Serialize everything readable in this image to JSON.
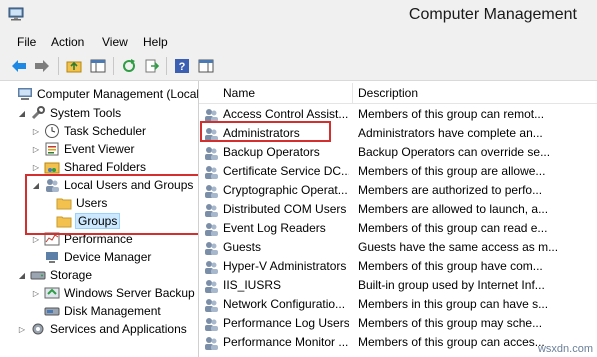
{
  "window": {
    "title": "Computer Management"
  },
  "menu": [
    {
      "label": "File"
    },
    {
      "label": "Action"
    },
    {
      "label": "View"
    },
    {
      "label": "Help"
    }
  ],
  "tree": [
    {
      "label": "Computer Management (Local",
      "icon": "computer-icon"
    },
    {
      "label": "System Tools",
      "icon": "tools-icon"
    },
    {
      "label": "Task Scheduler",
      "icon": "clock-icon"
    },
    {
      "label": "Event Viewer",
      "icon": "event-viewer-icon"
    },
    {
      "label": "Shared Folders",
      "icon": "shared-folder-icon"
    },
    {
      "label": "Local Users and Groups",
      "icon": "users-icon"
    },
    {
      "label": "Users",
      "icon": "folder-icon"
    },
    {
      "label": "Groups",
      "icon": "folder-icon"
    },
    {
      "label": "Performance",
      "icon": "performance-icon"
    },
    {
      "label": "Device Manager",
      "icon": "device-manager-icon"
    },
    {
      "label": "Storage",
      "icon": "storage-icon"
    },
    {
      "label": "Windows Server Backup",
      "icon": "backup-icon"
    },
    {
      "label": "Disk Management",
      "icon": "disk-icon"
    },
    {
      "label": "Services and Applications",
      "icon": "services-icon"
    }
  ],
  "list": {
    "columns": [
      "Name",
      "Description"
    ],
    "rows": [
      {
        "name": "Access Control Assist...",
        "description": "Members of this group can remot..."
      },
      {
        "name": "Administrators",
        "description": "Administrators have complete an..."
      },
      {
        "name": "Backup Operators",
        "description": "Backup Operators can override se..."
      },
      {
        "name": "Certificate Service DC...",
        "description": "Members of this group are allowe..."
      },
      {
        "name": "Cryptographic Operat...",
        "description": "Members are authorized to perfo..."
      },
      {
        "name": "Distributed COM Users",
        "description": "Members are allowed to launch, a..."
      },
      {
        "name": "Event Log Readers",
        "description": "Members of this group can read e..."
      },
      {
        "name": "Guests",
        "description": "Guests have the same access as m..."
      },
      {
        "name": "Hyper-V Administrators",
        "description": "Members of this group have com..."
      },
      {
        "name": "IIS_IUSRS",
        "description": "Built-in group used by Internet Inf..."
      },
      {
        "name": "Network Configuratio...",
        "description": "Members in this group can have s..."
      },
      {
        "name": "Performance Log Users",
        "description": "Members of this group may sche..."
      },
      {
        "name": "Performance Monitor ...",
        "description": "Members of this group can acces..."
      }
    ]
  },
  "watermark": "wsxdn.com",
  "colors": {
    "highlight_box": "#d32f2f",
    "selection": "#cce8ff",
    "toolbar_arrow": "#1e88e5"
  }
}
